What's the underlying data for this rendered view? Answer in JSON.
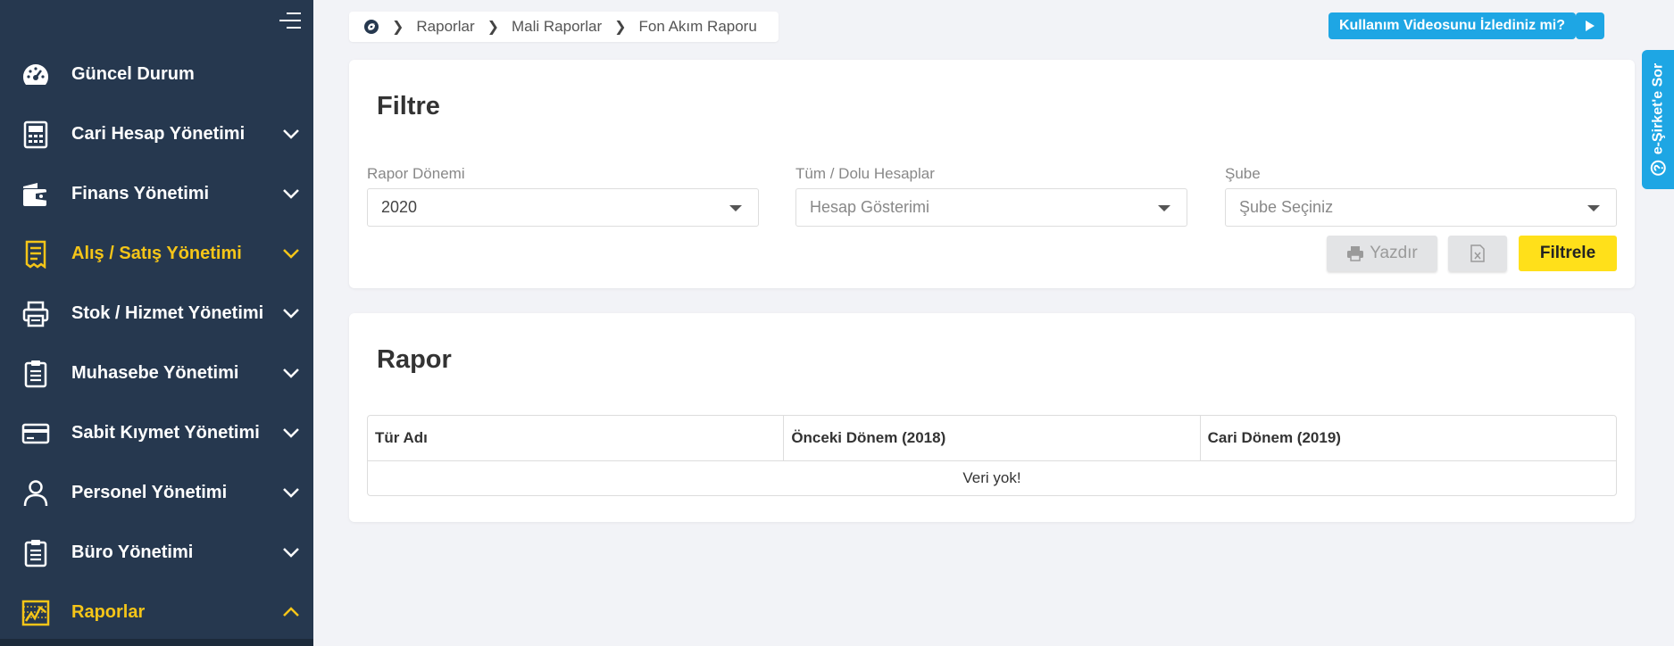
{
  "sidebar": {
    "items": [
      {
        "label": "Güncel Durum",
        "icon": "dashboard-icon",
        "active": false,
        "chevron": "none"
      },
      {
        "label": "Cari Hesap Yönetimi",
        "icon": "calculator-icon",
        "active": false,
        "chevron": "down"
      },
      {
        "label": "Finans Yönetimi",
        "icon": "wallet-icon",
        "active": false,
        "chevron": "down"
      },
      {
        "label": "Alış / Satış Yönetimi",
        "icon": "receipt-icon",
        "active": true,
        "chevron": "down"
      },
      {
        "label": "Stok / Hizmet Yönetimi",
        "icon": "printer-icon",
        "active": false,
        "chevron": "down"
      },
      {
        "label": "Muhasebe Yönetimi",
        "icon": "clipboard-icon",
        "active": false,
        "chevron": "down"
      },
      {
        "label": "Sabit Kıymet Yönetimi",
        "icon": "credit-card-icon",
        "active": false,
        "chevron": "down"
      },
      {
        "label": "Personel Yönetimi",
        "icon": "user-icon",
        "active": false,
        "chevron": "down"
      },
      {
        "label": "Büro Yönetimi",
        "icon": "clipboard-icon",
        "active": false,
        "chevron": "down"
      },
      {
        "label": "Raporlar",
        "icon": "chart-icon",
        "active": true,
        "chevron": "up"
      }
    ]
  },
  "breadcrumb": {
    "items": [
      "Raporlar",
      "Mali Raporlar",
      "Fon Akım Raporu"
    ]
  },
  "help": {
    "video_label": "Kullanım Videosunu İzlediniz mi?",
    "side_tab_label": "e-Şirket'e Sor"
  },
  "filter": {
    "title": "Filtre",
    "period": {
      "label": "Rapor Dönemi",
      "value": "2020"
    },
    "accounts": {
      "label": "Tüm / Dolu Hesaplar",
      "placeholder": "Hesap Gösterimi"
    },
    "branch": {
      "label": "Şube",
      "placeholder": "Şube Seçiniz"
    },
    "print_label": "Yazdır",
    "filter_label": "Filtrele"
  },
  "report": {
    "title": "Rapor",
    "columns": [
      "Tür Adı",
      "Önceki Dönem (2018)",
      "Cari Dönem (2019)"
    ],
    "empty_text": "Veri yok!"
  },
  "colors": {
    "sidebar_bg": "#26384f",
    "accent_yellow": "#f5c518",
    "info_blue": "#1ea6e4",
    "filter_button": "#ffe01a"
  }
}
